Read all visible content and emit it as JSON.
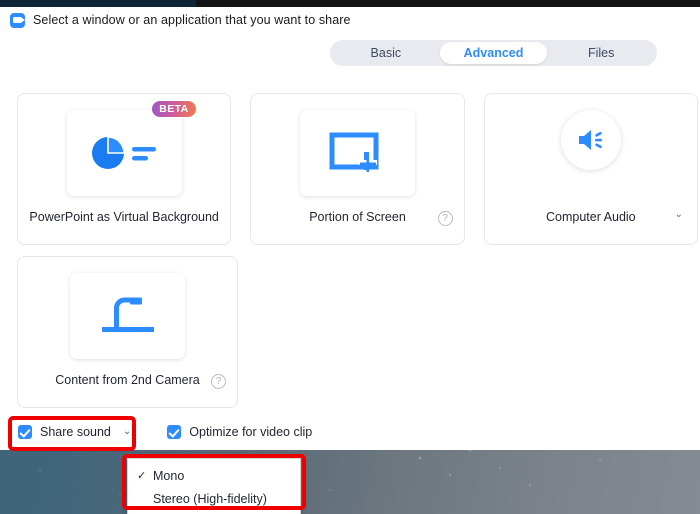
{
  "window": {
    "title": "Select a window or an application that you want to share",
    "logo_icon": "zoom-camera-icon"
  },
  "tabs": [
    {
      "label": "Basic",
      "active": false
    },
    {
      "label": "Advanced",
      "active": true
    },
    {
      "label": "Files",
      "active": false
    }
  ],
  "cards": [
    {
      "label": "PowerPoint as Virtual Background",
      "icon": "pie-chart-slide-icon",
      "badge": "BETA",
      "has_help": false,
      "has_chevron": false
    },
    {
      "label": "Portion of Screen",
      "icon": "screen-region-crosshair-icon",
      "badge": null,
      "has_help": true,
      "has_chevron": false
    },
    {
      "label": "Computer Audio",
      "icon": "speaker-volume-icon",
      "badge": null,
      "has_help": false,
      "has_chevron": true
    },
    {
      "label": "Content from 2nd Camera",
      "icon": "document-camera-icon",
      "badge": null,
      "has_help": true,
      "has_chevron": false
    }
  ],
  "options": [
    {
      "label": "Share sound",
      "checked": true,
      "has_chevron": true
    },
    {
      "label": "Optimize for video clip",
      "checked": true,
      "has_chevron": false
    }
  ],
  "audio_menu": {
    "items": [
      {
        "label": "Mono",
        "checked": true,
        "check_glyph": "✓"
      },
      {
        "label": "Stereo (High-fidelity)",
        "checked": false,
        "check_glyph": ""
      }
    ]
  },
  "help_glyph": "?",
  "chevron_glyph": "⌄",
  "colors": {
    "accent_blue": "#2D8CFF",
    "annotation_red": "#EE0000",
    "tab_track": "#E9EAEF",
    "badge_gradient_start": "#9B57C4",
    "badge_gradient_end": "#F4784A"
  }
}
